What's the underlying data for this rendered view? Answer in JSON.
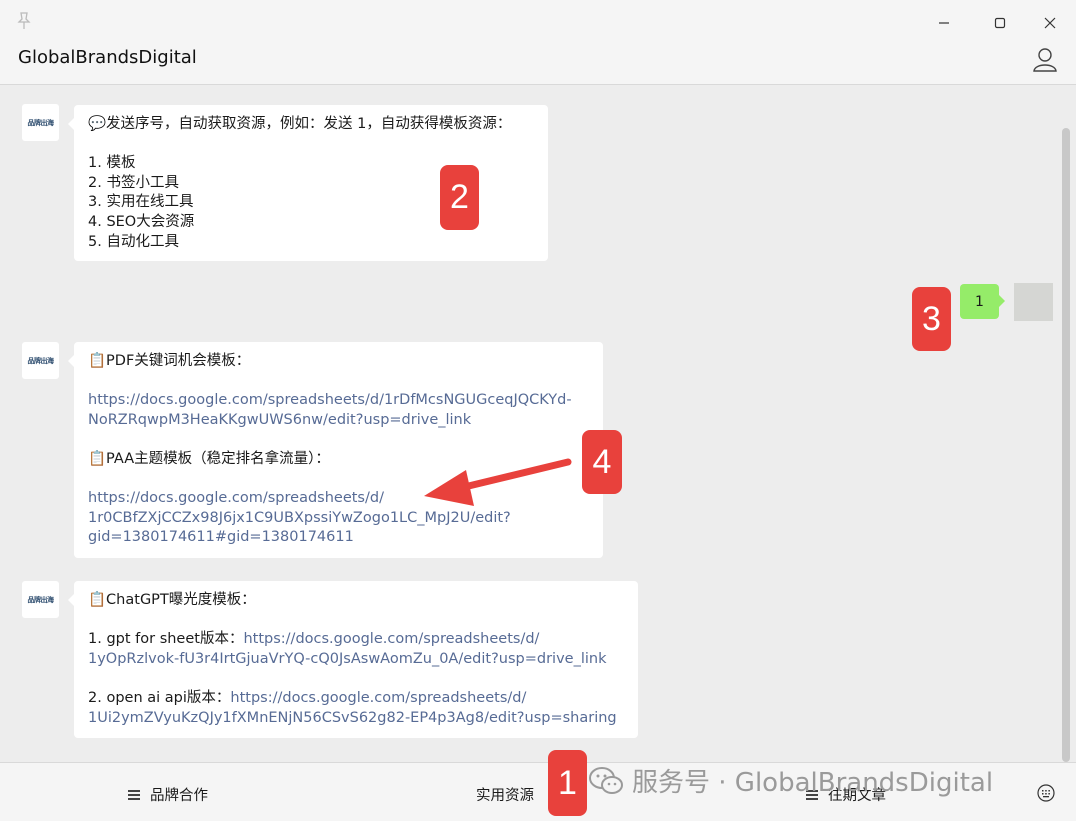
{
  "window": {
    "title": "GlobalBrandsDigital"
  },
  "messages": [
    {
      "from": "bot",
      "avatar_text": "品牌出海",
      "lines": [
        {
          "text": "💬发送序号，自动获取资源，例如：发送 1，自动获得模板资源：",
          "link": false
        },
        {
          "text": "",
          "link": false
        },
        {
          "text": "1. 模板",
          "link": false
        },
        {
          "text": "2. 书签小工具",
          "link": false
        },
        {
          "text": "3. 实用在线工具",
          "link": false
        },
        {
          "text": "4. SEO大会资源",
          "link": false
        },
        {
          "text": "5. 自动化工具",
          "link": false
        }
      ]
    },
    {
      "from": "me",
      "text": "1"
    },
    {
      "from": "bot",
      "avatar_text": "品牌出海",
      "lines": [
        {
          "text": "📋PDF关键词机会模板：",
          "link": false
        },
        {
          "text": "",
          "link": false
        },
        {
          "text": "https://docs.google.com/spreadsheets/d/1rDfMcsNGUGceqJQCKYd-",
          "link": true
        },
        {
          "text": "NoRZRqwpM3HeaKKgwUWS6nw/edit?usp=drive_link",
          "link": true
        },
        {
          "text": "",
          "link": false
        },
        {
          "text": "📋PAA主题模板（稳定排名拿流量）：",
          "link": false
        },
        {
          "text": "",
          "link": false
        },
        {
          "text": "https://docs.google.com/spreadsheets/d/",
          "link": true
        },
        {
          "text": "1r0CBfZXjCCZx98J6jx1C9UBXpssiYwZogo1LC_MpJ2U/edit?",
          "link": true
        },
        {
          "text": "gid=1380174611#gid=1380174611",
          "link": true
        }
      ]
    },
    {
      "from": "bot",
      "avatar_text": "品牌出海",
      "lines": [
        {
          "text": "📋ChatGPT曝光度模板：",
          "link": false
        },
        {
          "text": "",
          "link": false
        },
        {
          "segments": [
            {
              "text": "1. gpt for sheet版本：",
              "link": false
            },
            {
              "text": "https://docs.google.com/spreadsheets/d/",
              "link": true
            }
          ]
        },
        {
          "text": "1yOpRzlvok-fU3r4IrtGjuaVrYQ-cQ0JsAswAomZu_0A/edit?usp=drive_link",
          "link": true
        },
        {
          "text": "",
          "link": false
        },
        {
          "segments": [
            {
              "text": "2. open ai api版本：",
              "link": false
            },
            {
              "text": "https://docs.google.com/spreadsheets/d/",
              "link": true
            }
          ]
        },
        {
          "text": "1Ui2ymZVyuKzQJy1fXMnENjN56CSvS62g82-EP4p3Ag8/edit?usp=sharing",
          "link": true
        }
      ]
    }
  ],
  "badges": [
    "2",
    "3",
    "4",
    "1"
  ],
  "bottom_menu": {
    "items": [
      "品牌合作",
      "实用资源",
      "往期文章"
    ]
  },
  "watermark": "服务号 · GlobalBrandsDigital",
  "colors": {
    "badge": "#e8413c",
    "link": "#576b95",
    "my_bubble": "#95ec69",
    "background": "#ededed"
  },
  "icons": [
    "pin-icon",
    "minimize-icon",
    "maximize-icon",
    "close-icon",
    "user-icon",
    "menu-icon",
    "keyboard-icon",
    "arrow-annotation-icon",
    "wechat-logo-icon"
  ]
}
